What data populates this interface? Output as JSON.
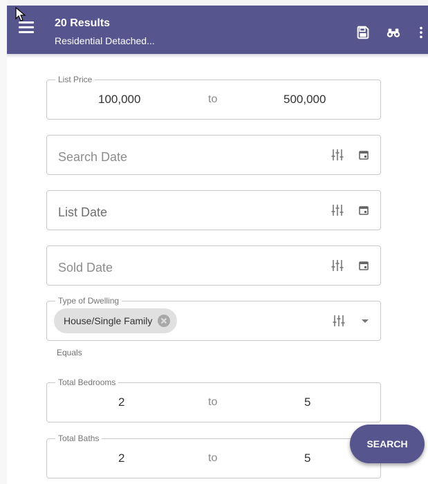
{
  "header": {
    "title": "20 Results",
    "subtitle": "Residential Detached...",
    "icons": [
      "menu-icon",
      "save-icon",
      "binoculars-icon",
      "more-vert-icon"
    ],
    "color": "#57558e"
  },
  "list_price": {
    "label": "List Price",
    "from": "100,000",
    "to_label": "to",
    "to": "500,000"
  },
  "search_date": {
    "placeholder": "Search Date"
  },
  "list_date": {
    "placeholder": "List Date"
  },
  "sold_date": {
    "placeholder": "Sold Date"
  },
  "dwelling": {
    "label": "Type of Dwelling",
    "chip": "House/Single Family",
    "helper": "Equals"
  },
  "bedrooms": {
    "label": "Total Bedrooms",
    "from": "2",
    "to_label": "to",
    "to": "5"
  },
  "baths": {
    "label": "Total Baths",
    "from": "2",
    "to_label": "to",
    "to": "5"
  },
  "search_button": {
    "label": "SEARCH"
  }
}
